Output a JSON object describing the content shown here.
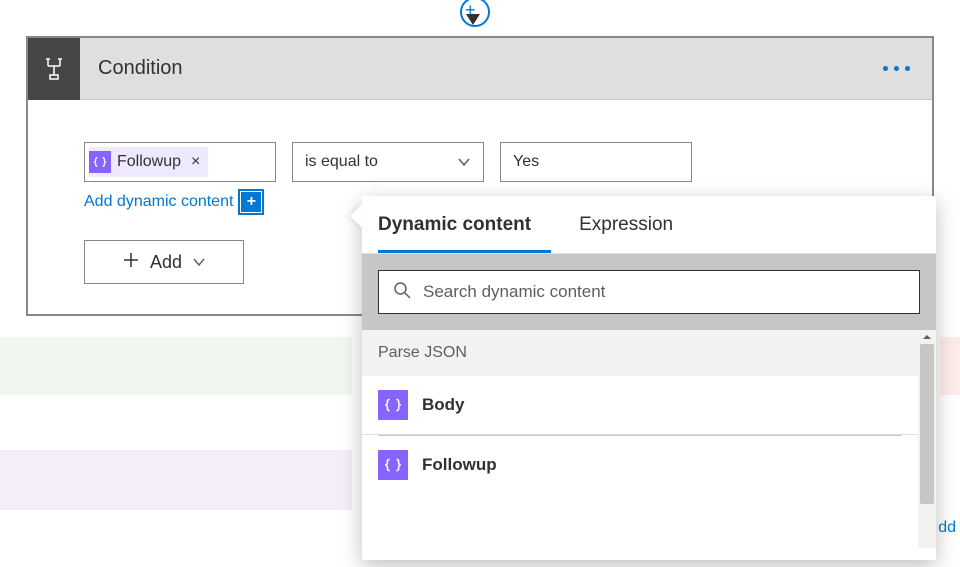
{
  "card": {
    "title": "Condition"
  },
  "condition": {
    "left_token": {
      "label": "Followup"
    },
    "operator": "is equal to",
    "right_value": "Yes"
  },
  "links": {
    "add_dynamic": "Add dynamic content"
  },
  "buttons": {
    "add": "Add"
  },
  "flyout": {
    "tabs": {
      "dynamic": "Dynamic content",
      "expression": "Expression"
    },
    "search_placeholder": "Search dynamic content",
    "group": "Parse JSON",
    "items": [
      {
        "label": "Body"
      },
      {
        "label": "Followup"
      }
    ]
  },
  "partial": {
    "bottom_link": "dd"
  }
}
